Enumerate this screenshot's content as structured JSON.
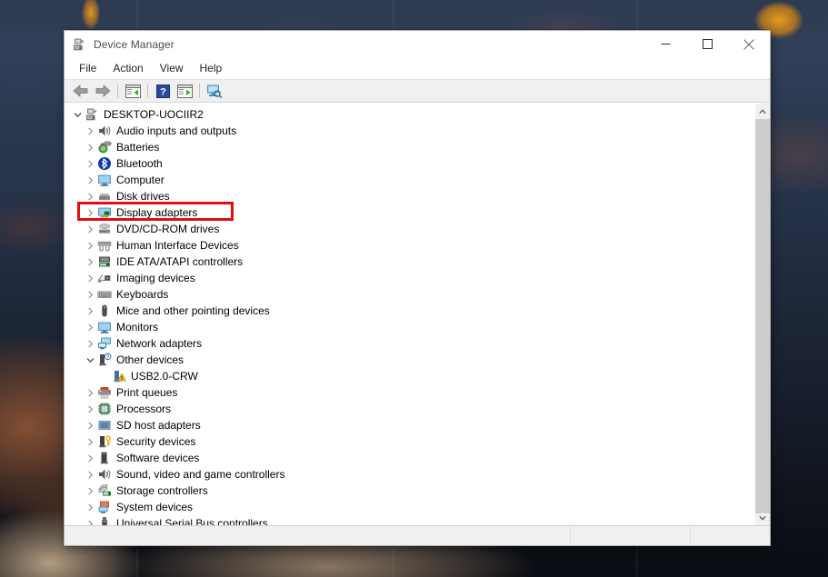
{
  "window": {
    "title": "Device Manager",
    "title_icon": "device-manager-icon",
    "minimize_label": "Minimize",
    "maximize_label": "Maximize",
    "close_label": "Close"
  },
  "menubar": {
    "items": [
      {
        "label": "File",
        "name": "menu-file"
      },
      {
        "label": "Action",
        "name": "menu-action"
      },
      {
        "label": "View",
        "name": "menu-view"
      },
      {
        "label": "Help",
        "name": "menu-help"
      }
    ]
  },
  "toolbar": {
    "buttons": [
      {
        "name": "back-button",
        "icon": "arrow-left-icon",
        "tooltip": "Back"
      },
      {
        "name": "forward-button",
        "icon": "arrow-right-icon",
        "tooltip": "Forward"
      },
      {
        "name": "show-hide-console-tree-button",
        "icon": "console-tree-icon",
        "tooltip": "Show/Hide Console Tree"
      },
      {
        "name": "help-button",
        "icon": "question-mark-icon",
        "tooltip": "Help"
      },
      {
        "name": "properties-button",
        "icon": "properties-icon",
        "tooltip": "Properties"
      },
      {
        "name": "scan-for-hardware-changes-button",
        "icon": "scan-hardware-icon",
        "tooltip": "Scan for hardware changes"
      }
    ]
  },
  "tree": {
    "root": {
      "label": "DESKTOP-UOCIIR2",
      "icon": "computer-root-icon",
      "expanded": true,
      "level": 0
    },
    "items": [
      {
        "label": "Audio inputs and outputs",
        "icon": "speaker-icon",
        "expanded": false,
        "level": 1,
        "name": "tree-item-audio-inputs-and-outputs"
      },
      {
        "label": "Batteries",
        "icon": "battery-icon",
        "expanded": false,
        "level": 1,
        "name": "tree-item-batteries"
      },
      {
        "label": "Bluetooth",
        "icon": "bluetooth-icon",
        "expanded": false,
        "level": 1,
        "name": "tree-item-bluetooth"
      },
      {
        "label": "Computer",
        "icon": "monitor-icon",
        "expanded": false,
        "level": 1,
        "name": "tree-item-computer"
      },
      {
        "label": "Disk drives",
        "icon": "disk-drive-icon",
        "expanded": false,
        "level": 1,
        "name": "tree-item-disk-drives"
      },
      {
        "label": "Display adapters",
        "icon": "display-adapter-icon",
        "expanded": false,
        "level": 1,
        "name": "tree-item-display-adapters",
        "highlighted": true
      },
      {
        "label": "DVD/CD-ROM drives",
        "icon": "optical-drive-icon",
        "expanded": false,
        "level": 1,
        "name": "tree-item-dvd-cd-rom-drives"
      },
      {
        "label": "Human Interface Devices",
        "icon": "hid-icon",
        "expanded": false,
        "level": 1,
        "name": "tree-item-human-interface-devices"
      },
      {
        "label": "IDE ATA/ATAPI controllers",
        "icon": "ide-controller-icon",
        "expanded": false,
        "level": 1,
        "name": "tree-item-ide-ata-atapi-controllers"
      },
      {
        "label": "Imaging devices",
        "icon": "camera-icon",
        "expanded": false,
        "level": 1,
        "name": "tree-item-imaging-devices"
      },
      {
        "label": "Keyboards",
        "icon": "keyboard-icon",
        "expanded": false,
        "level": 1,
        "name": "tree-item-keyboards"
      },
      {
        "label": "Mice and other pointing devices",
        "icon": "mouse-icon",
        "expanded": false,
        "level": 1,
        "name": "tree-item-mice-and-other-pointing-devices"
      },
      {
        "label": "Monitors",
        "icon": "monitor-icon",
        "expanded": false,
        "level": 1,
        "name": "tree-item-monitors"
      },
      {
        "label": "Network adapters",
        "icon": "network-adapter-icon",
        "expanded": false,
        "level": 1,
        "name": "tree-item-network-adapters"
      },
      {
        "label": "Other devices",
        "icon": "other-device-question-icon",
        "expanded": true,
        "level": 1,
        "name": "tree-item-other-devices"
      },
      {
        "label": "USB2.0-CRW",
        "icon": "device-warning-icon",
        "level": 2,
        "name": "tree-item-usb20-crw",
        "leaf": true
      },
      {
        "label": "Print queues",
        "icon": "printer-icon",
        "expanded": false,
        "level": 1,
        "name": "tree-item-print-queues"
      },
      {
        "label": "Processors",
        "icon": "processor-icon",
        "expanded": false,
        "level": 1,
        "name": "tree-item-processors"
      },
      {
        "label": "SD host adapters",
        "icon": "sd-host-adapter-icon",
        "expanded": false,
        "level": 1,
        "name": "tree-item-sd-host-adapters"
      },
      {
        "label": "Security devices",
        "icon": "security-device-icon",
        "expanded": false,
        "level": 1,
        "name": "tree-item-security-devices"
      },
      {
        "label": "Software devices",
        "icon": "software-device-icon",
        "expanded": false,
        "level": 1,
        "name": "tree-item-software-devices"
      },
      {
        "label": "Sound, video and game controllers",
        "icon": "speaker-icon",
        "expanded": false,
        "level": 1,
        "name": "tree-item-sound-video-and-game-controllers"
      },
      {
        "label": "Storage controllers",
        "icon": "storage-controller-icon",
        "expanded": false,
        "level": 1,
        "name": "tree-item-storage-controllers"
      },
      {
        "label": "System devices",
        "icon": "system-device-icon",
        "expanded": false,
        "level": 1,
        "name": "tree-item-system-devices"
      },
      {
        "label": "Universal Serial Bus controllers",
        "icon": "usb-icon",
        "expanded": false,
        "level": 1,
        "name": "tree-item-universal-serial-bus-controllers"
      }
    ]
  },
  "scrollbar": {
    "up_arrow": "chevron-up-icon",
    "down_arrow": "chevron-down-icon"
  },
  "statusbar": {
    "cells": [
      "",
      "",
      ""
    ]
  },
  "annotation": {
    "target_label": "Display adapters",
    "color": "#e30b14"
  },
  "colors": {
    "annotation_red": "#e30b14",
    "window_bg": "#ffffff",
    "chrome_gray": "#f0f0f0",
    "scrollbar_thumb": "#cdcdcd",
    "title_text": "#4c4c4c"
  }
}
